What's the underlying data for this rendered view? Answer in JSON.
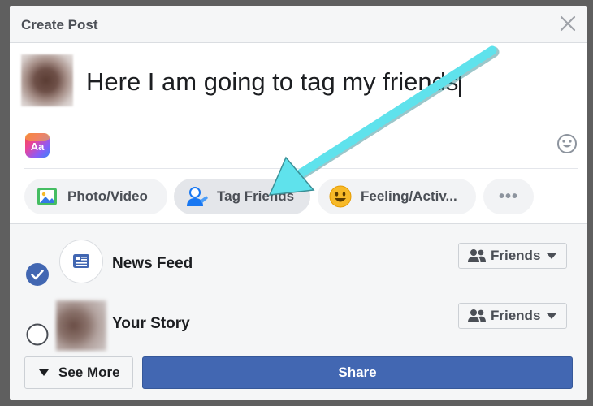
{
  "dialog": {
    "title": "Create Post"
  },
  "composer": {
    "post_text": "Here I am going to tag my friends",
    "text_bg_label": "Aa"
  },
  "actions": [
    {
      "label": "Photo/Video",
      "icon": "photo-icon"
    },
    {
      "label": "Tag Friends",
      "icon": "tag-friends-icon"
    },
    {
      "label": "Feeling/Activ...",
      "icon": "smiley-emoji-icon"
    },
    {
      "label": "•••",
      "icon": "more-icon"
    }
  ],
  "audience": [
    {
      "label": "News Feed",
      "selected": true,
      "privacy": "Friends"
    },
    {
      "label": "Your Story",
      "selected": false,
      "privacy": "Friends"
    }
  ],
  "footer": {
    "see_more_label": "See More",
    "share_label": "Share"
  },
  "colors": {
    "brand_blue": "#4267b2",
    "annotation_arrow": "#58e1ea"
  }
}
